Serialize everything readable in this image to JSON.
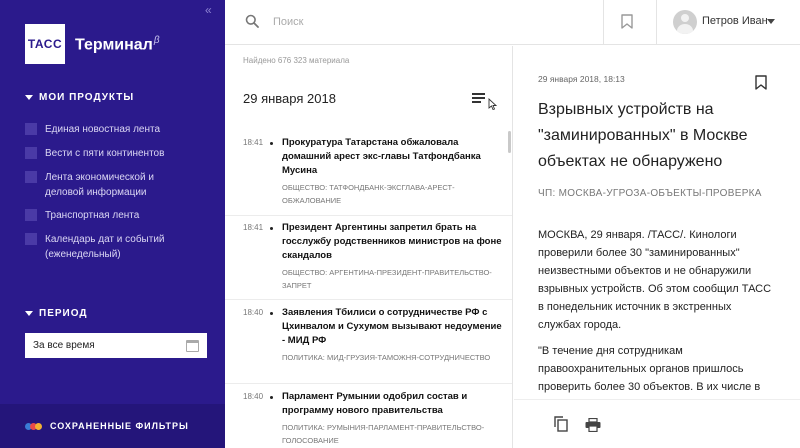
{
  "sidebar": {
    "logo": "ТАСС",
    "brand": "Терминал",
    "brand_sup": "β",
    "products_title": "МОИ ПРОДУКТЫ",
    "products": [
      "Единая новостная лента",
      "Вести с пяти континентов",
      "Лента экономической и деловой информации",
      "Транспортная лента",
      "Календарь дат и событий (еженедельный)"
    ],
    "period_title": "ПЕРИОД",
    "period_value": "За все время",
    "saved_filters": "СОХРАНЕННЫЕ ФИЛЬТРЫ",
    "collapse_icon": "«",
    "colors": {
      "background": "#2b1a8c",
      "dots": [
        "#3a7bd5",
        "#e84a4a",
        "#f2b134"
      ]
    }
  },
  "topbar": {
    "search_placeholder": "Поиск",
    "user_name": "Петров Иван"
  },
  "list": {
    "found": "Найдено 676 323 материала",
    "date": "29 января 2018",
    "items": [
      {
        "time": "18:41",
        "title": "Прокуратура Татарстана обжаловала домашний арест экс-главы Татфондбанка Мусина",
        "tags": "ОБЩЕСТВО: ТАТФОНДБАНК-ЭКСГЛАВА-АРЕСТ-ОБЖАЛОВАНИЕ"
      },
      {
        "time": "18:41",
        "title": "Президент Аргентины запретил брать на госслужбу родственников министров на фоне скандалов",
        "tags": "ОБЩЕСТВО: АРГЕНТИНА-ПРЕЗИДЕНТ-ПРАВИТЕЛЬСТВО-ЗАПРЕТ"
      },
      {
        "time": "18:40",
        "title": "Заявления Тбилиси о сотрудничестве РФ с Цхинвалом и Сухумом вызывают недоумение - МИД РФ",
        "tags": "ПОЛИТИКА: МИД-ГРУЗИЯ-ТАМОЖНЯ-СОТРУДНИЧЕСТВО"
      },
      {
        "time": "18:40",
        "title": "Парламент Румынии одобрил состав и программу нового правительства",
        "tags": "ПОЛИТИКА: РУМЫНИЯ-ПАРЛАМЕНТ-ПРАВИТЕЛЬСТВО-ГОЛОСОВАНИЕ"
      }
    ]
  },
  "article": {
    "datetime": "29 января 2018, 18:13",
    "title": "Взрывных устройств на \"заминированных\" в Москве объектах не обнаружено",
    "rubric": "ЧП: МОСКВА-УГРОЗА-ОБЪЕКТЫ-ПРОВЕРКА",
    "paragraphs": [
      "МОСКВА, 29 января. /ТАСС/. Кинологи проверили более 30 \"заминированных\" неизвестными объектов и не обнаружили взрывных устройств. Об этом сообщил ТАСС в понедельник источник в экстренных службах города.",
      "\"В течение дня сотрудникам правоохранительных органов пришлось проверить более 30 объектов. В их числе в основном здания органов власти, крупные торговые центры\","
    ]
  }
}
